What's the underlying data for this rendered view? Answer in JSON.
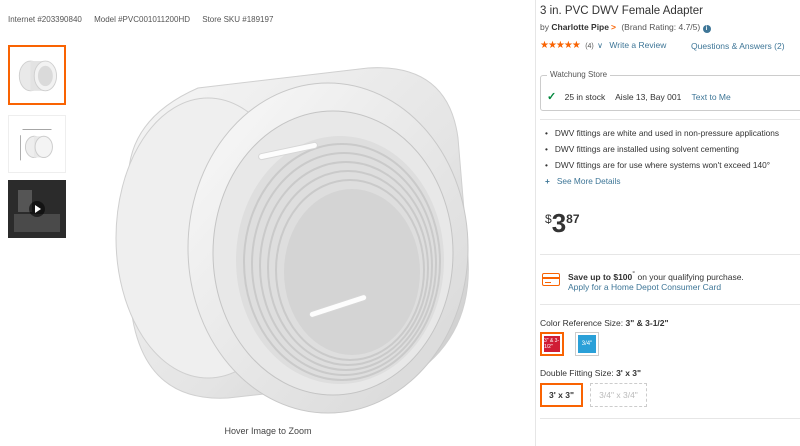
{
  "product_ids": {
    "internet": "Internet #203390840",
    "model": "Model #PVC001011200HD",
    "sku": "Store SKU #189197"
  },
  "gallery": {
    "thumbnails": [
      {
        "label": "Main product image",
        "selected": true
      },
      {
        "label": "Dimensions image",
        "selected": false
      },
      {
        "label": "Product video",
        "selected": false
      }
    ],
    "zoom_note": "Hover Image to Zoom"
  },
  "product": {
    "title": "3 in. PVC DWV Female Adapter",
    "by": "by",
    "brand": "Charlotte Pipe",
    "brand_rating": "(Brand Rating: 4.7/5)",
    "stars": "★★★★★",
    "rating_value": 4.5,
    "review_count": "(4)",
    "write_review": "Write a Review",
    "qa": "Questions & Answers (2)"
  },
  "store": {
    "name": "Watchung Store",
    "stock": "25 in stock",
    "aisle": "Aisle 13, Bay 001",
    "text_link": "Text to Me"
  },
  "bullets": [
    "DWV fittings are white and used in non-pressure applications",
    "DWV fittings are installed using solvent cementing",
    "DWV fittings are for use where systems won't exceed 140°"
  ],
  "see_more": "See More Details",
  "price": {
    "currency": "$",
    "dollars": "3",
    "cents": "87"
  },
  "credit": {
    "save_prefix": "Save up to $100",
    "save_sup": "°",
    "save_suffix": " on your qualifying purchase.",
    "apply": "Apply for a Home Depot Consumer Card"
  },
  "color_option": {
    "label": "Color Reference Size:",
    "value": "3\" & 3-1/2\"",
    "swatches": [
      {
        "text": "3\" & 3-1/2\"",
        "color": "#d01c35",
        "selected": true
      },
      {
        "text": "3/4\"",
        "color": "#2aa0d8",
        "selected": false
      }
    ]
  },
  "fitting_option": {
    "label": "Double Fitting Size:",
    "value": "3' x 3\"",
    "choices": [
      {
        "text": "3' x 3\"",
        "selected": true
      },
      {
        "text": "3/4\" x 3/4\"",
        "selected": false
      }
    ]
  },
  "colors": {
    "accent": "#f96302",
    "link": "#3e7697",
    "in_stock": "#00873c"
  }
}
